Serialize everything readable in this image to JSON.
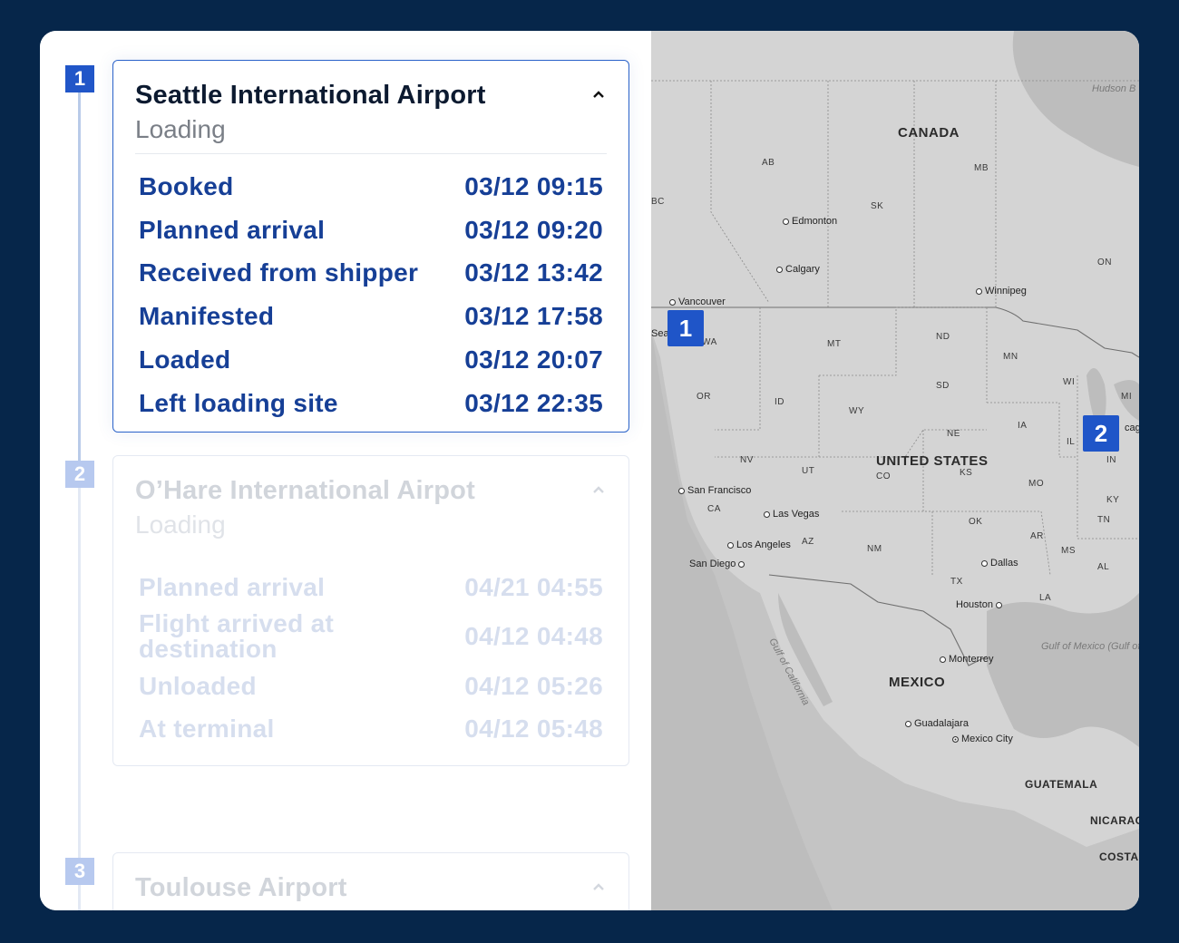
{
  "timeline": {
    "stops": [
      {
        "step": "1",
        "title": "Seattle International Airport",
        "subtitle": "Loading",
        "state": "expanded-active",
        "events": [
          {
            "label": "Booked",
            "time": "03/12 09:15"
          },
          {
            "label": "Planned arrival",
            "time": "03/12 09:20"
          },
          {
            "label": "Received from shipper",
            "time": "03/12 13:42"
          },
          {
            "label": "Manifested",
            "time": "03/12 17:58"
          },
          {
            "label": "Loaded",
            "time": "03/12 20:07"
          },
          {
            "label": "Left loading site",
            "time": "03/12 22:35"
          }
        ]
      },
      {
        "step": "2",
        "title": "O’Hare International Airpot",
        "subtitle": "Loading",
        "state": "faded",
        "events": [
          {
            "label": "Planned arrival",
            "time": "04/21 04:55"
          },
          {
            "label": "Flight arrived at destination",
            "time": "04/12 04:48"
          },
          {
            "label": "Unloaded",
            "time": "04/12 05:26"
          },
          {
            "label": "At terminal",
            "time": "04/12 05:48"
          }
        ]
      },
      {
        "step": "3",
        "title": "Toulouse Airport",
        "state": "faded"
      }
    ]
  },
  "map": {
    "countries": [
      "CANADA",
      "UNITED STATES",
      "MEXICO",
      "GUATEMALA",
      "NICARAG",
      "COSTA"
    ],
    "regions": [
      "AB",
      "SK",
      "MB",
      "ON",
      "BC",
      "MT",
      "ND",
      "MN",
      "WI",
      "MI",
      "SD",
      "WY",
      "ID",
      "OR",
      "NE",
      "IA",
      "IL",
      "IN",
      "NV",
      "UT",
      "CO",
      "KS",
      "MO",
      "KY",
      "CA",
      "AZ",
      "NM",
      "OK",
      "TN",
      "AR",
      "MS",
      "AL",
      "TX",
      "LA",
      "WA"
    ],
    "cities": [
      "Edmonton",
      "Calgary",
      "Vancouver",
      "Winnipeg",
      "San Francisco",
      "Las Vegas",
      "Los Angeles",
      "San Diego",
      "Dallas",
      "Houston",
      "Monterrey",
      "Guadalajara",
      "Mexico City",
      "Seatt",
      "cago"
    ],
    "water": [
      "Hudson B",
      "Gulf of California",
      "Gulf of Mexico (Gulf of America)"
    ],
    "pins": [
      "1",
      "2"
    ],
    "colors": {
      "pin": "#1f55c8",
      "land": "#d4d4d4",
      "water": "#bdbdbd"
    }
  },
  "colors": {
    "background": "#06264a",
    "accent": "#2156c8",
    "event_text": "#163f96"
  }
}
